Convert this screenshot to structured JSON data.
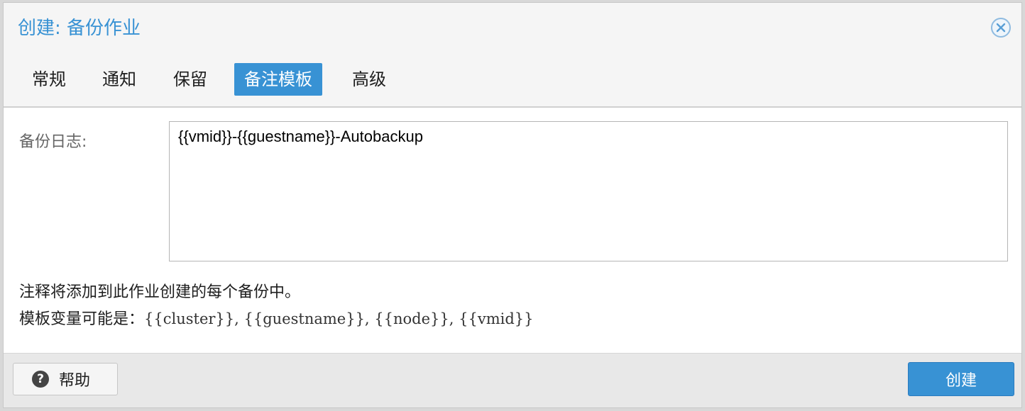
{
  "dialog": {
    "title": "创建: 备份作业"
  },
  "tabs": [
    {
      "label": "常规",
      "active": false
    },
    {
      "label": "通知",
      "active": false
    },
    {
      "label": "保留",
      "active": false
    },
    {
      "label": "备注模板",
      "active": true
    },
    {
      "label": "高级",
      "active": false
    }
  ],
  "form": {
    "notes_label": "备份日志:",
    "notes_value": "{{vmid}}-{{guestname}}-Autobackup",
    "help_line1": "注释将添加到此作业创建的每个备份中。",
    "help_line2_prefix": "模板变量可能是：",
    "help_line2_vars": "{{cluster}}, {{guestname}}, {{node}}, {{vmid}}"
  },
  "footer": {
    "help_label": "帮助",
    "help_icon_glyph": "?",
    "create_label": "创建"
  },
  "colors": {
    "accent": "#3892d4"
  }
}
